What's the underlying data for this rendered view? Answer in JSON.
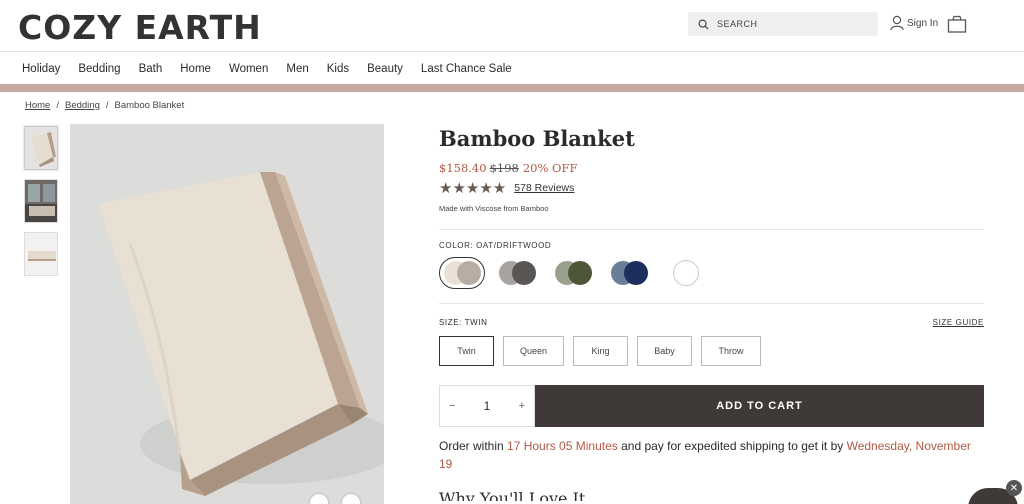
{
  "header": {
    "logo": "COZY EARTH",
    "search_placeholder": "SEARCH",
    "signin_label": "Sign In"
  },
  "nav": {
    "items": [
      "Holiday",
      "Bedding",
      "Bath",
      "Home",
      "Women",
      "Men",
      "Kids",
      "Beauty",
      "Last Chance Sale"
    ]
  },
  "breadcrumb": {
    "home": "Home",
    "bedding": "Bedding",
    "current": "Bamboo Blanket"
  },
  "product": {
    "title": "Bamboo Blanket",
    "price": "$158.40",
    "old_price": "$198",
    "discount": "20% OFF",
    "stars": "★★★★★",
    "reviews": "578 Reviews",
    "made_with": "Made with Viscose from Bamboo",
    "color_label": "COLOR: OAT/DRIFTWOOD",
    "swatches": [
      {
        "name": "oat-driftwood",
        "c1": "#e9e1d6",
        "c2": "#b8ada3",
        "selected": true
      },
      {
        "name": "charcoal",
        "c1": "#a8a39f",
        "c2": "#5a5655"
      },
      {
        "name": "olive",
        "c1": "#9aa08f",
        "c2": "#4d5637"
      },
      {
        "name": "navy",
        "c1": "#6a7e97",
        "c2": "#1d2f5c"
      },
      {
        "name": "white",
        "c1": "#ffffff",
        "c2": "#ffffff"
      }
    ],
    "size_label": "SIZE: TWIN",
    "size_guide": "SIZE GUIDE",
    "sizes": [
      "Twin",
      "Queen",
      "King",
      "Baby",
      "Throw"
    ],
    "quantity": "1",
    "minus": "−",
    "plus": "+",
    "add_to_cart": "ADD TO CART",
    "order_prefix": "Order within ",
    "order_time": "17 Hours 05 Minutes",
    "order_middle": " and pay for expedited shipping to get it by ",
    "order_date": "Wednesday, November 19",
    "next_heading": "Why You'll Love It"
  },
  "colors": {
    "accent": "#b05a45",
    "nav_bar": "#c8a9a0",
    "button_dark": "#3f3a38"
  }
}
